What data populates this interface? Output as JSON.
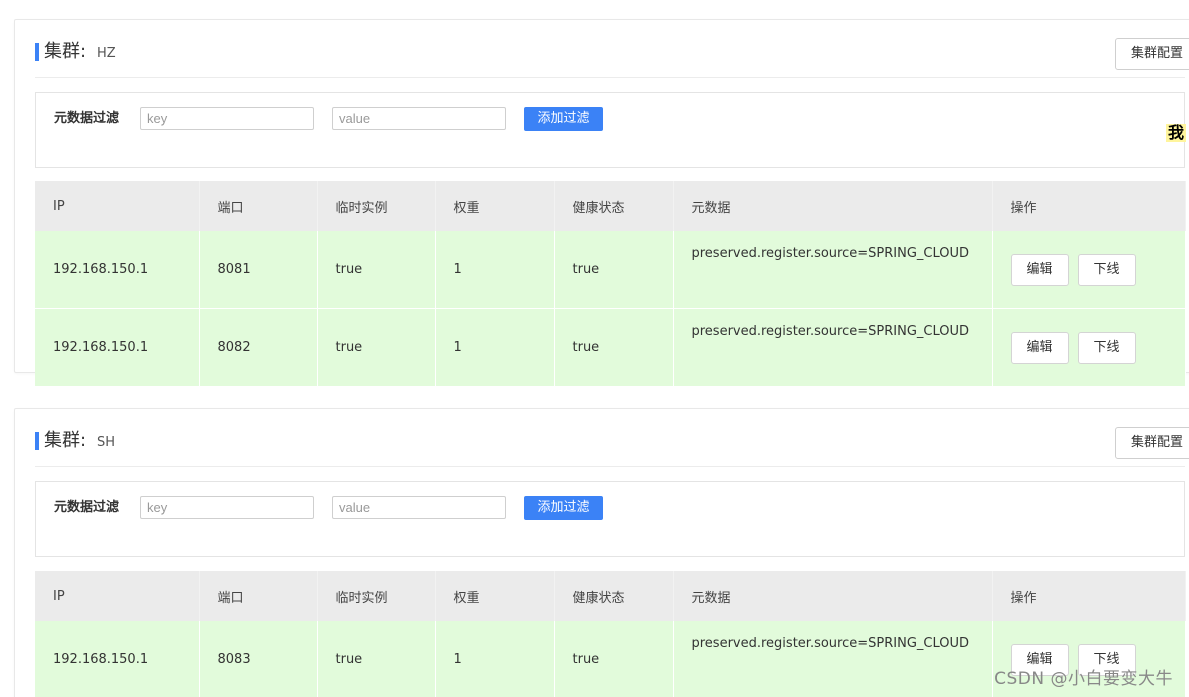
{
  "clusters": [
    {
      "title_label": "集群:",
      "name": "HZ",
      "config_button": "集群配置",
      "filter": {
        "label": "元数据过滤",
        "key_placeholder": "key",
        "value_placeholder": "value",
        "add_button": "添加过滤"
      },
      "columns": [
        "IP",
        "端口",
        "临时实例",
        "权重",
        "健康状态",
        "元数据",
        "操作"
      ],
      "rows": [
        {
          "ip": "192.168.150.1",
          "port": "8081",
          "ephemeral": "true",
          "weight": "1",
          "healthy": "true",
          "metadata": "preserved.register.source=SPRING_CLOUD",
          "edit": "编辑",
          "offline": "下线"
        },
        {
          "ip": "192.168.150.1",
          "port": "8082",
          "ephemeral": "true",
          "weight": "1",
          "healthy": "true",
          "metadata": "preserved.register.source=SPRING_CLOUD",
          "edit": "编辑",
          "offline": "下线"
        }
      ]
    },
    {
      "title_label": "集群:",
      "name": "SH",
      "config_button": "集群配置",
      "filter": {
        "label": "元数据过滤",
        "key_placeholder": "key",
        "value_placeholder": "value",
        "add_button": "添加过滤"
      },
      "columns": [
        "IP",
        "端口",
        "临时实例",
        "权重",
        "健康状态",
        "元数据",
        "操作"
      ],
      "rows": [
        {
          "ip": "192.168.150.1",
          "port": "8083",
          "ephemeral": "true",
          "weight": "1",
          "healthy": "true",
          "metadata": "preserved.register.source=SPRING_CLOUD",
          "edit": "编辑",
          "offline": "下线"
        }
      ]
    }
  ],
  "side_text": "我",
  "watermark": "CSDN @小白要变大牛",
  "colors": {
    "accent": "#3b82f6",
    "row_bg": "#e2fbdb",
    "header_bg": "#ebebeb"
  }
}
